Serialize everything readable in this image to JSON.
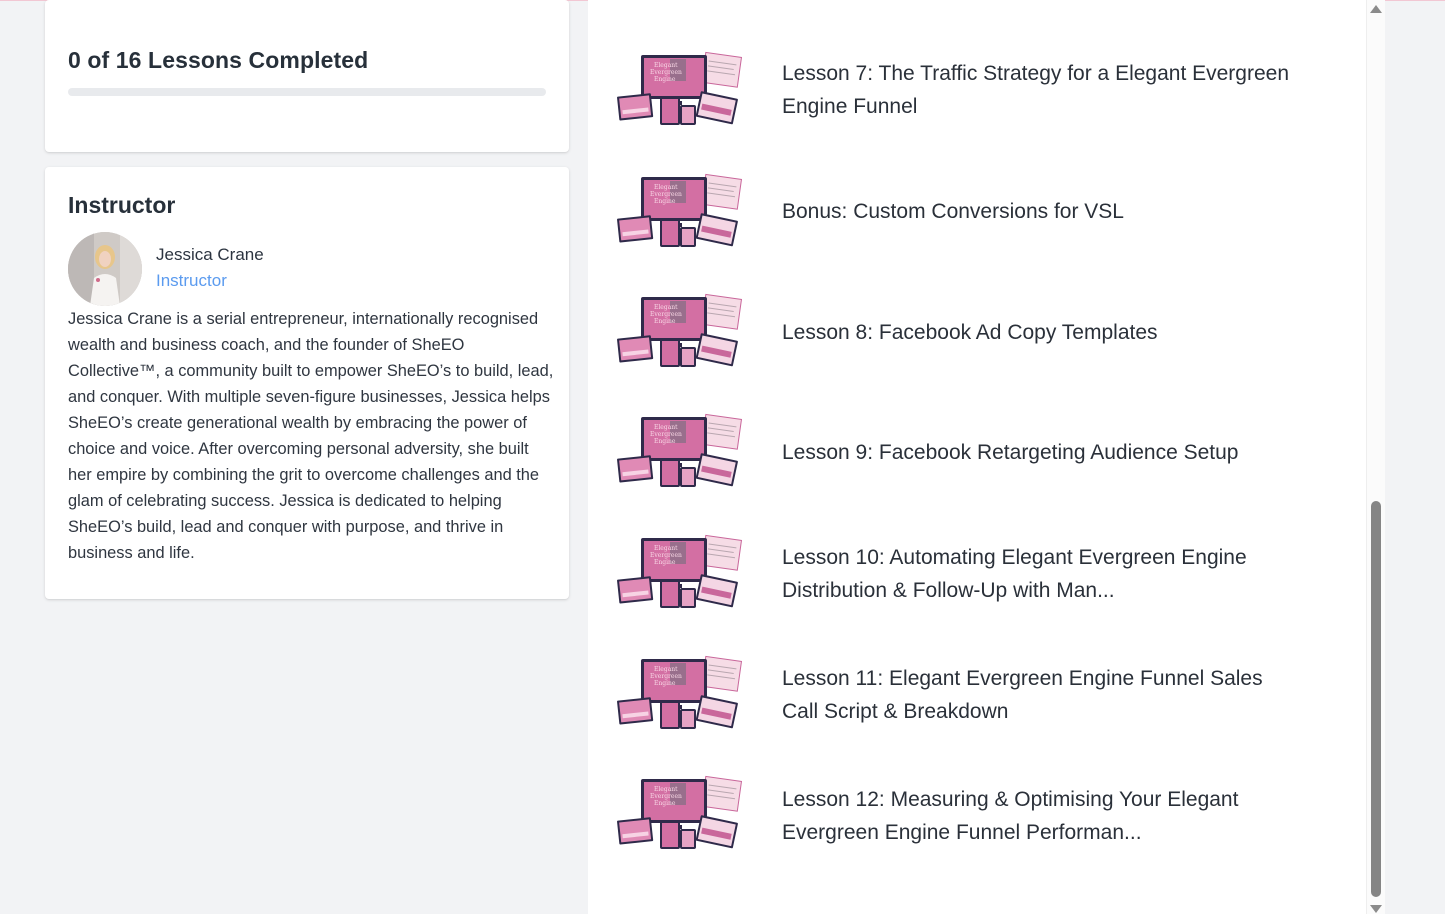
{
  "progress": {
    "text": "0 of 16 Lessons Completed",
    "completed": 0,
    "total": 16,
    "fraction": 0
  },
  "instructor": {
    "heading": "Instructor",
    "name": "Jessica Crane",
    "role": "Instructor",
    "bio": "Jessica Crane is a serial entrepreneur, internationally recognised wealth and business coach, and the founder of SheEO Collective™, a community built to empower SheEO’s to build, lead, and conquer. With multiple seven-figure businesses, Jessica helps SheEO’s create generational wealth by embracing the power of choice and voice. After overcoming personal adversity, she built her empire by combining the grit to overcome challenges and the glam of celebrating success. Jessica is dedicated to helping SheEO’s build, lead and conquer with purpose, and thrive in business and life."
  },
  "lessons": [
    {
      "title": "Lesson 7: The Traffic Strategy for a Elegant Evergreen Engine Funnel"
    },
    {
      "title": "Bonus: Custom Conversions for VSL"
    },
    {
      "title": "Lesson 8: Facebook Ad Copy Templates"
    },
    {
      "title": "Lesson 9: Facebook Retargeting Audience Setup"
    },
    {
      "title": "Lesson 10: Automating Elegant Evergreen Engine Distribution & Follow-Up with Man..."
    },
    {
      "title": "Lesson 11: Elegant Evergreen Engine Funnel Sales Call Script & Breakdown"
    },
    {
      "title": "Lesson 12: Measuring & Optimising Your Elegant Evergreen Engine Funnel Performan..."
    }
  ],
  "thumbnail": {
    "icon": "course-thumbnail-icon",
    "lettering": "Elegant Evergreen Engine"
  },
  "colors": {
    "progress_track": "#e8eaed",
    "role_link": "#5b9bef",
    "thumb_pink": "#c9679b",
    "thumb_dark": "#2f2a4a",
    "scrollbar": "#858585"
  }
}
